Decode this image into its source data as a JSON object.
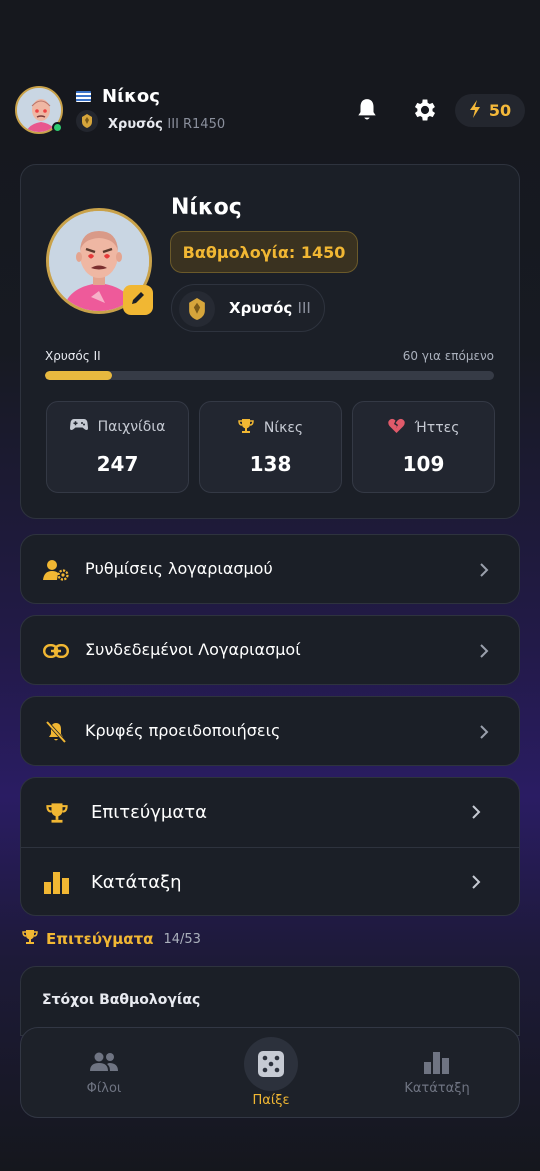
{
  "header": {
    "name": "Νίκος",
    "rank_name": "Χρυσός",
    "rank_tier": "III",
    "rating": "R1450",
    "energy": "50",
    "icons": [
      "bell-icon",
      "gear-icon",
      "bolt-icon"
    ]
  },
  "profile": {
    "name": "Νίκος",
    "rating_label": "Βαθμολογία: 1450",
    "rank_name": "Χρυσός",
    "rank_tier": "III",
    "progress_label": "Χρυσός II",
    "progress_remaining": "60 για επόμενο",
    "progress_fraction": 0.15,
    "stats": [
      {
        "label": "Παιχνίδια",
        "value": "247",
        "icon": "gamepad-icon"
      },
      {
        "label": "Νίκες",
        "value": "138",
        "icon": "trophy-icon"
      },
      {
        "label": "Ήττες",
        "value": "109",
        "icon": "broken-heart-icon"
      }
    ]
  },
  "menu": [
    {
      "label": "Ρυθμίσεις λογαριασμού",
      "icon": "user-gear-icon"
    },
    {
      "label": "Συνδεδεμένοι Λογαριασμοί",
      "icon": "link-icon"
    },
    {
      "label": "Κρυφές προειδοποιήσεις",
      "icon": "bell-slash-icon"
    }
  ],
  "menu_group": [
    {
      "label": "Επιτεύγματα",
      "icon": "trophy-icon"
    },
    {
      "label": "Κατάταξη",
      "icon": "bar-chart-icon"
    }
  ],
  "achievements": {
    "title": "Επιτεύγματα",
    "count": "14/53",
    "section": "Στόχοι Βαθμολογίας"
  },
  "nav": {
    "friends": "Φίλοι",
    "play": "Παίξε",
    "ranking": "Κατάταξη"
  },
  "colors": {
    "accent": "#f1b733",
    "card": "#1b1f27",
    "online": "#2ecc71",
    "loss": "#e05a6a"
  }
}
